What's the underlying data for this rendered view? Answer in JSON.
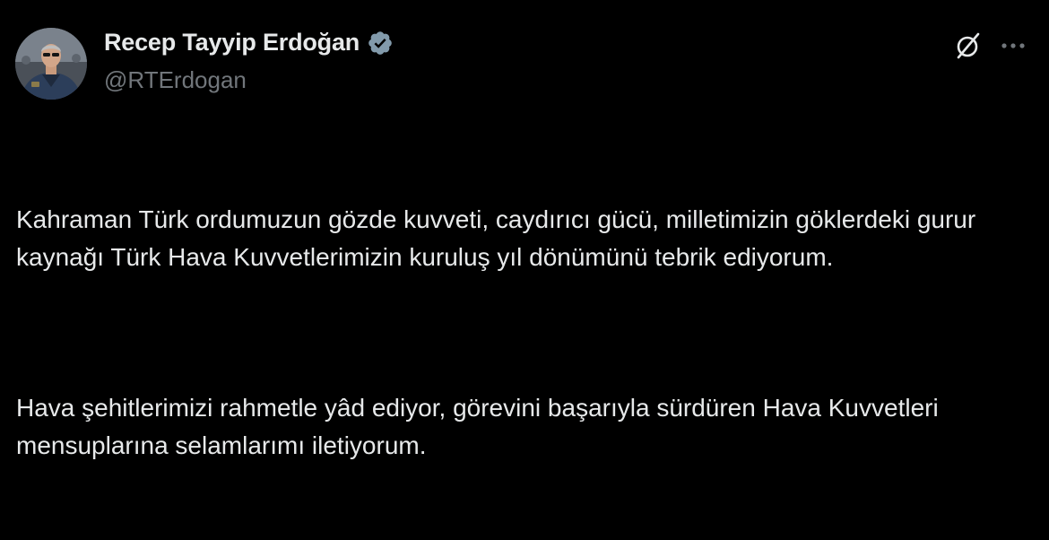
{
  "author": {
    "display_name": "Recep Tayyip Erdoğan",
    "handle": "@RTErdogan",
    "verified": true,
    "verified_badge_color": "#829aab"
  },
  "header_actions": {
    "grok_icon": "grok-icon",
    "more_icon": "more-horizontal-icon"
  },
  "tweet": {
    "paragraphs": [
      "Kahraman Türk ordumuzun gözde kuvveti, caydırıcı gücü, milletimizin göklerdeki gurur kaynağı Türk Hava Kuvvetlerimizin kuruluş yıl dönümünü tebrik ediyorum.",
      "Hava şehitlerimizi rahmetle yâd ediyor, görevini başarıyla sürdüren Hava Kuvvetleri mensuplarına selamlarımı iletiyorum."
    ]
  },
  "colors": {
    "background": "#000000",
    "primary_text": "#e7e9ea",
    "secondary_text": "#71767b"
  }
}
